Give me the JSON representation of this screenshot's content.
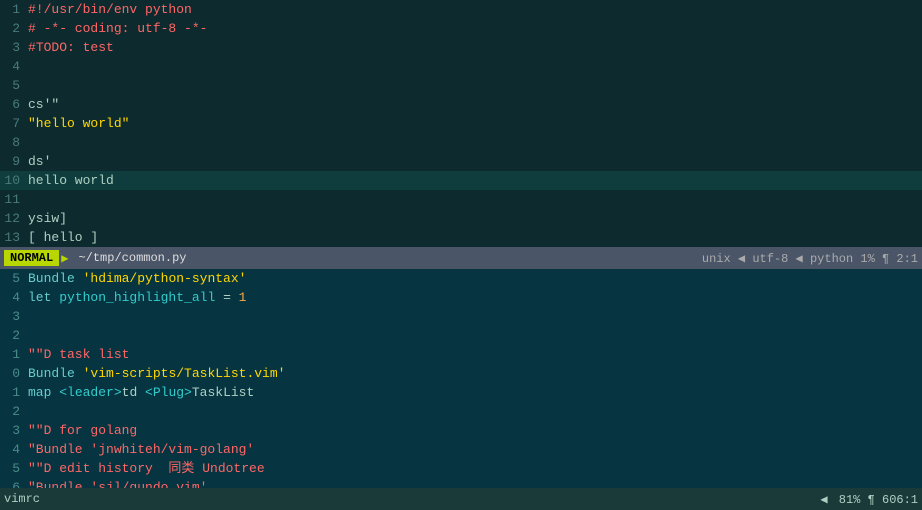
{
  "editor1": {
    "lines": [
      {
        "num": "1",
        "content": "#!/usr/bin/env python",
        "style": "shebang"
      },
      {
        "num": "2",
        "content": "# -*- coding: utf-8 -*-",
        "style": "comment"
      },
      {
        "num": "3",
        "content": "#TODO: test",
        "style": "todo"
      },
      {
        "num": "4",
        "content": "",
        "style": "normal"
      },
      {
        "num": "5",
        "content": "",
        "style": "normal"
      },
      {
        "num": "6",
        "content": "cs'\"",
        "style": "normal"
      },
      {
        "num": "7",
        "content": "\"hello world\"",
        "style": "string"
      },
      {
        "num": "8",
        "content": "",
        "style": "normal"
      },
      {
        "num": "9",
        "content": "ds'",
        "style": "normal"
      },
      {
        "num": "10",
        "content": "hello world",
        "style": "highlight"
      },
      {
        "num": "11",
        "content": "",
        "style": "normal"
      },
      {
        "num": "12",
        "content": "ysiw]",
        "style": "normal"
      },
      {
        "num": "13",
        "content": "[ hello ]",
        "style": "bracket"
      }
    ]
  },
  "statusbar1": {
    "mode": "NORMAL",
    "arrow": "▶",
    "path": "~/tmp/common.py",
    "right": "unix ◀ utf-8 ◀ python     1%  ¶  2:1"
  },
  "editor2": {
    "lines": [
      {
        "num": "5",
        "content": "Bundle 'hdima/python-syntax'",
        "highlight_parts": [
          "Bundle ",
          "'hdima/python-syntax'"
        ]
      },
      {
        "num": "4",
        "content": "let python_highlight_all = 1",
        "highlight_parts": [
          "let ",
          "python_highlight_all ",
          "= ",
          "1"
        ]
      },
      {
        "num": "3",
        "content": "",
        "style": "normal"
      },
      {
        "num": "2",
        "content": "",
        "style": "normal"
      },
      {
        "num": "1",
        "content": "\"\"D task list",
        "style": "comment"
      },
      {
        "num": "0",
        "content": "Bundle 'vim-scripts/TaskList.vim'",
        "style": "bundle"
      },
      {
        "num": "1",
        "content": "map <leader>td <Plug>TaskList",
        "style": "map"
      },
      {
        "num": "2",
        "content": "",
        "style": "normal"
      },
      {
        "num": "3",
        "content": "\"\"D for golang",
        "style": "comment"
      },
      {
        "num": "4",
        "content": "\"Bundle 'jnwhiteh/vim-golang'",
        "style": "comment"
      },
      {
        "num": "5",
        "content": "\"\"D edit history  同类 Undotree",
        "style": "comment"
      },
      {
        "num": "6",
        "content": "\"Bundle 'sjl/gundo.vim'",
        "style": "comment"
      }
    ]
  },
  "statusbar2": {
    "filename": "vimrc",
    "right": "81%  ¶  606:1"
  }
}
